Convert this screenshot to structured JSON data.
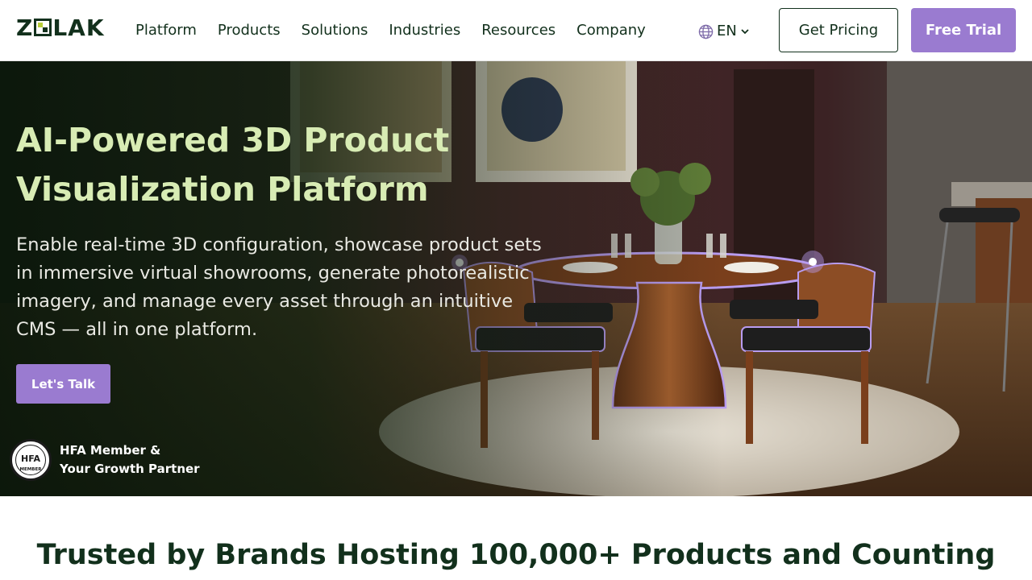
{
  "header": {
    "logo_text_left": "Z",
    "logo_text_right": "LAK",
    "nav": [
      "Platform",
      "Products",
      "Solutions",
      "Industries",
      "Resources",
      "Company"
    ],
    "language": "EN",
    "get_pricing_label": "Get Pricing",
    "free_trial_label": "Free Trial"
  },
  "hero": {
    "title": "AI-Powered 3D Product Visualization Platform",
    "subtitle": "Enable real-time 3D configuration, showcase product sets in immersive virtual showrooms, generate photorealistic imagery, and manage every asset through an intuitive CMS — all in one platform.",
    "cta_label": "Let's Talk",
    "badge_line1": "HFA Member &",
    "badge_line2": "Your Growth Partner",
    "seal_text": "HFA",
    "seal_bottom_text": "MEMBER"
  },
  "trusted": {
    "heading": "Trusted by Brands Hosting 100,000+ Products and Counting"
  },
  "colors": {
    "brand_dark": "#12301c",
    "accent_purple": "#9a7bd0",
    "hero_title": "#d8ecb4"
  },
  "icons": {
    "language": "globe-icon",
    "language_caret": "chevron-down-icon"
  }
}
